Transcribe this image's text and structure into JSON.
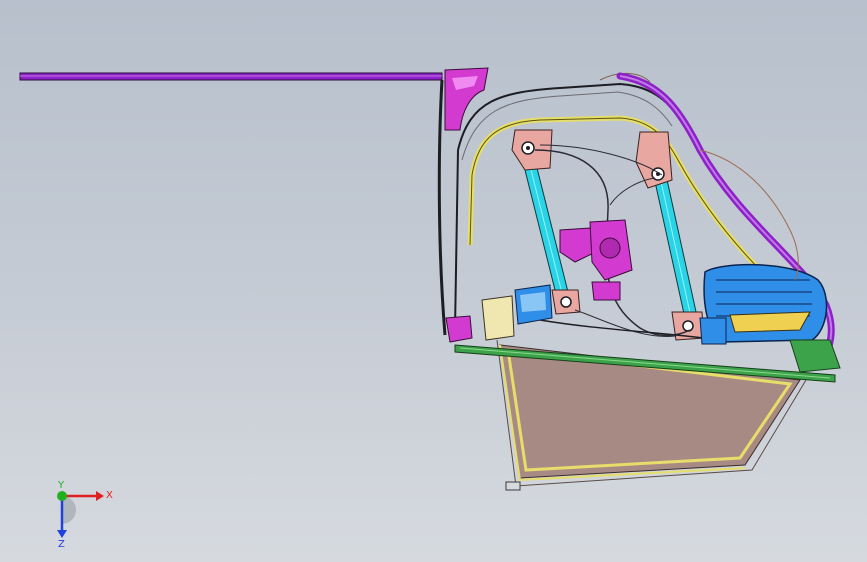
{
  "viewport": {
    "colors": {
      "background_top": "#b7c0cc",
      "background_bottom": "#d6dadf",
      "glass": "#a88a84",
      "glass_frame": "#e6dd6a",
      "rail": "#8e20c8",
      "bracket": "#d23ad0",
      "regulator_rail": "#28d4e6",
      "regulator_mount": "#e8a7a0",
      "actuator": "#2f8ee8",
      "belt_strip": "#3da34a",
      "wire": "#2a2a34"
    }
  },
  "triad": {
    "x_label": "X",
    "y_label": "Y",
    "z_label": "Z",
    "x_color": "#e02020",
    "y_color": "#20b020",
    "z_color": "#2040e0"
  }
}
